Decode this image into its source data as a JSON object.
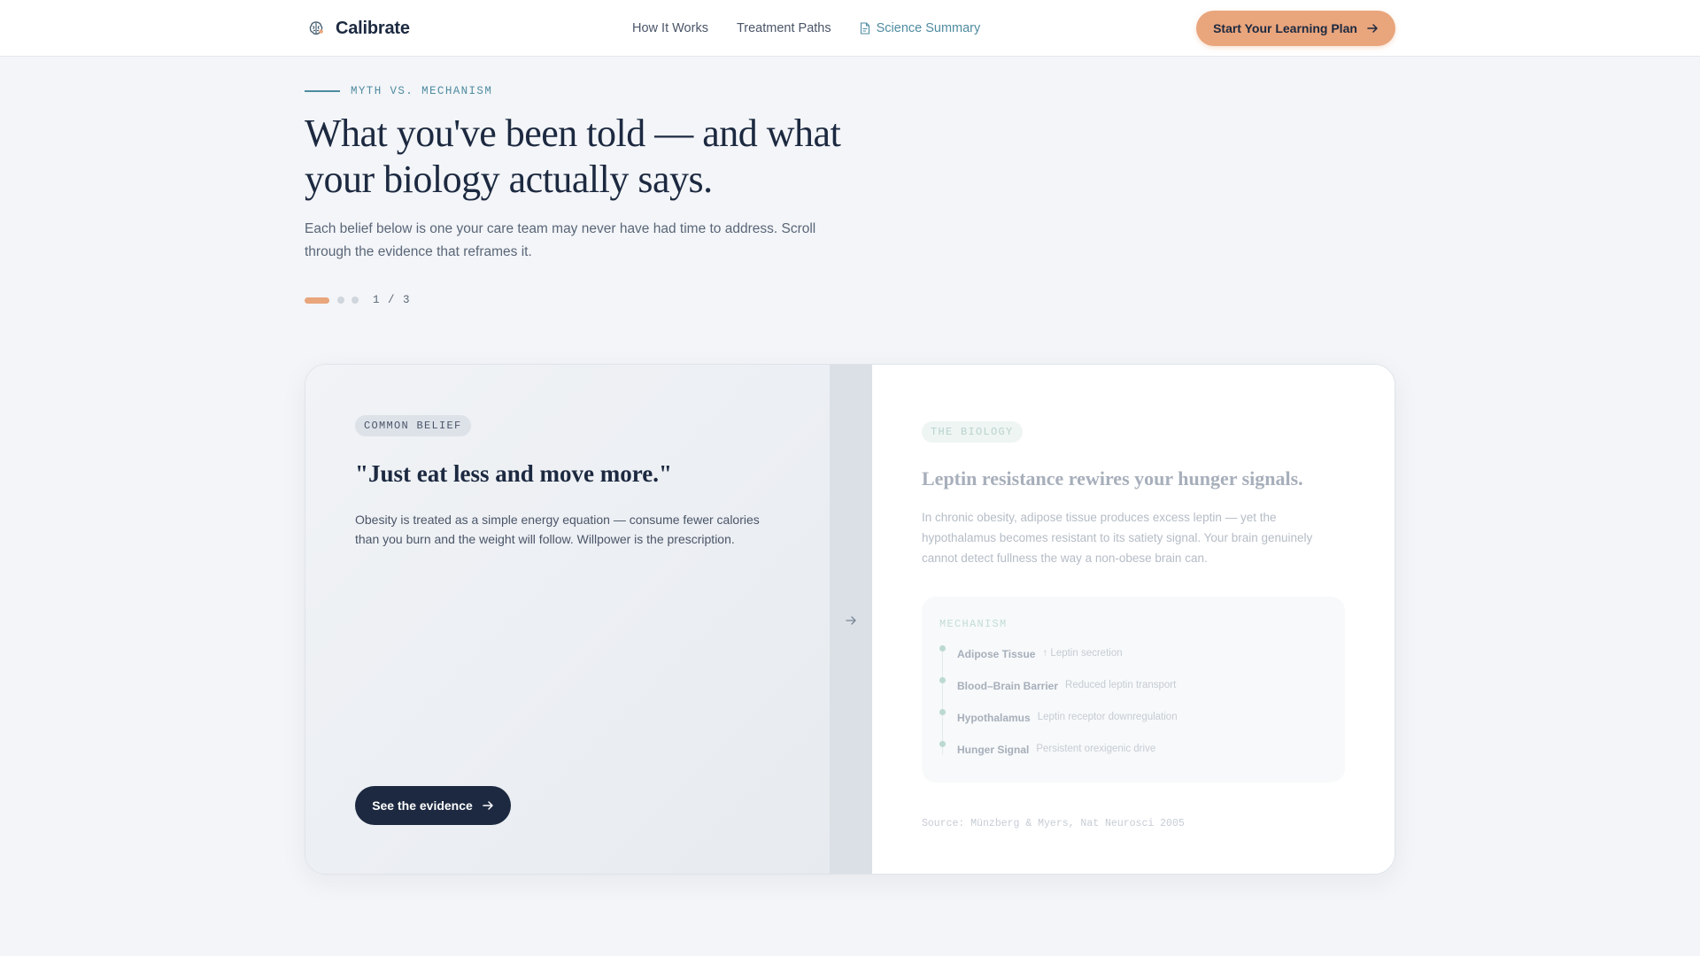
{
  "nav": {
    "brand": "Calibrate",
    "links": [
      {
        "label": "How It Works"
      },
      {
        "label": "Treatment Paths"
      },
      {
        "label": "Science Summary"
      }
    ],
    "cta_label": "Start Your Learning Plan"
  },
  "hero": {
    "eyebrow": "MYTH VS. MECHANISM",
    "headline": "What you've been told — and what your biology actually says.",
    "subtext": "Each belief below is one your care team may never have had time to address. Scroll through the evidence that reframes it.",
    "pager": {
      "current": 1,
      "total": 3,
      "label": "1 / 3"
    }
  },
  "card": {
    "belief": {
      "pill": "COMMON BELIEF",
      "quote": "\"Just eat less and move more.\"",
      "body": "Obesity is treated as a simple energy equation — consume fewer calories than you burn and the weight will follow. Willpower is the prescription.",
      "button_label": "See the evidence"
    },
    "biology": {
      "pill": "THE BIOLOGY",
      "title": "Leptin resistance rewires your hunger signals.",
      "body": "In chronic obesity, adipose tissue produces excess leptin — yet the hypothalamus becomes resistant to its satiety signal. Your brain genuinely cannot detect fullness the way a non-obese brain can.",
      "mechanism_label": "MECHANISM",
      "mechanism": [
        {
          "name": "Adipose Tissue",
          "desc": "↑ Leptin secretion"
        },
        {
          "name": "Blood–Brain Barrier",
          "desc": "Reduced leptin transport"
        },
        {
          "name": "Hypothalamus",
          "desc": "Leptin receptor downregulation"
        },
        {
          "name": "Hunger Signal",
          "desc": "Persistent orexigenic drive"
        }
      ],
      "source": "Source: Münzberg & Myers, Nat Neurosci 2005"
    }
  },
  "colors": {
    "accent": "#e9a57c",
    "navy": "#1c2940",
    "teal": "#4f8ba0"
  },
  "icons": {
    "brand": "brain-icon",
    "science": "document-icon",
    "arrow": "arrow-right-icon"
  }
}
